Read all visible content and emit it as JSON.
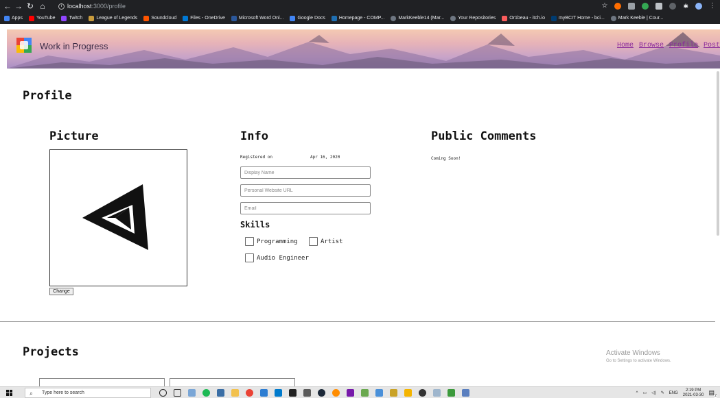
{
  "browser": {
    "url_host": "localhost",
    "url_path": ":3000/profile",
    "bookmarks": [
      {
        "label": "Apps",
        "color": "#4285f4"
      },
      {
        "label": "YouTube",
        "color": "#ff0000"
      },
      {
        "label": "Twitch",
        "color": "#9146ff"
      },
      {
        "label": "League of Legends",
        "color": "#c89b3c"
      },
      {
        "label": "Soundcloud",
        "color": "#ff5500"
      },
      {
        "label": "Files - OneDrive",
        "color": "#0078d4"
      },
      {
        "label": "Microsoft Word Onl...",
        "color": "#2b579a"
      },
      {
        "label": "Google Docs",
        "color": "#4285f4"
      },
      {
        "label": "Homepage - COMP...",
        "color": "#1f6fb2"
      },
      {
        "label": "MarkKeeble14 (Mar...",
        "color": "#6e7681"
      },
      {
        "label": "Your Repositories",
        "color": "#6e7681"
      },
      {
        "label": "Or1beau - itch.io",
        "color": "#fa5c5c"
      },
      {
        "label": "myBCIT Home - bci...",
        "color": "#003c71"
      },
      {
        "label": "Mark Keeble | Cour...",
        "color": "#6e7681"
      }
    ]
  },
  "site": {
    "title": "Work in Progress",
    "nav": [
      "Home",
      "Browse",
      "Profile",
      "Post"
    ]
  },
  "profile": {
    "page_title": "Profile",
    "picture_heading": "Picture",
    "change_button": "Change",
    "info_heading": "Info",
    "registered_label": "Registered on",
    "registered_date": "Apr 16, 2020",
    "display_name_placeholder": "Display Name",
    "website_placeholder": "Personal Website URL",
    "email_placeholder": "Email",
    "skills_heading": "Skills",
    "skills": [
      "Programming",
      "Artist",
      "Audio Engineer"
    ],
    "comments_heading": "Public Comments",
    "comments_text": "Coming Soon!",
    "projects_heading": "Projects"
  },
  "watermark": {
    "line1": "Activate Windows",
    "line2": "Go to Settings to activate Windows."
  },
  "taskbar": {
    "search_placeholder": "Type here to search",
    "time": "2:19 PM",
    "date": "2021-03-30",
    "lang": "ENG",
    "notification_count": "2"
  }
}
